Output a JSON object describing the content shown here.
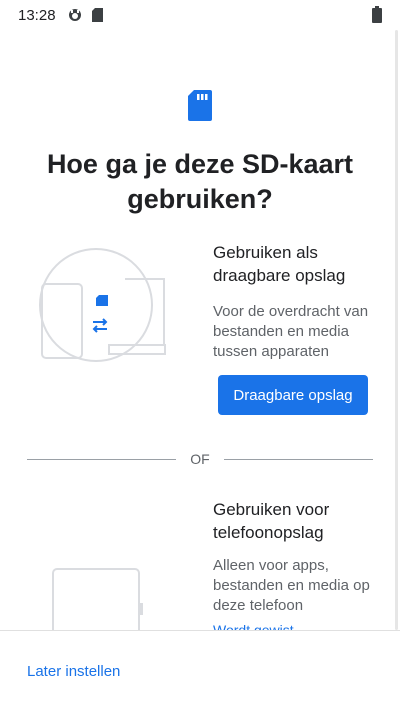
{
  "status_bar": {
    "time": "13:28",
    "icons": [
      "notification-app-icon",
      "sd-card-icon",
      "battery-icon"
    ]
  },
  "title": "Hoe ga je deze SD-kaart gebruiken?",
  "portable": {
    "title": "Gebruiken als draagbare opslag",
    "description": "Voor de overdracht van bestanden en media tussen apparaten",
    "button_label": "Draagbare opslag"
  },
  "divider_label": "OF",
  "internal": {
    "title": "Gebruiken voor telefoonopslag",
    "description": "Alleen voor apps, bestanden en media op deze telefoon",
    "partial_warning": "Wordt gewist..."
  },
  "footer": {
    "later_label": "Later instellen"
  },
  "colors": {
    "accent": "#1a73e8",
    "text_primary": "#202124",
    "text_secondary": "#5f6368",
    "illustration_stroke": "#dadce0"
  }
}
